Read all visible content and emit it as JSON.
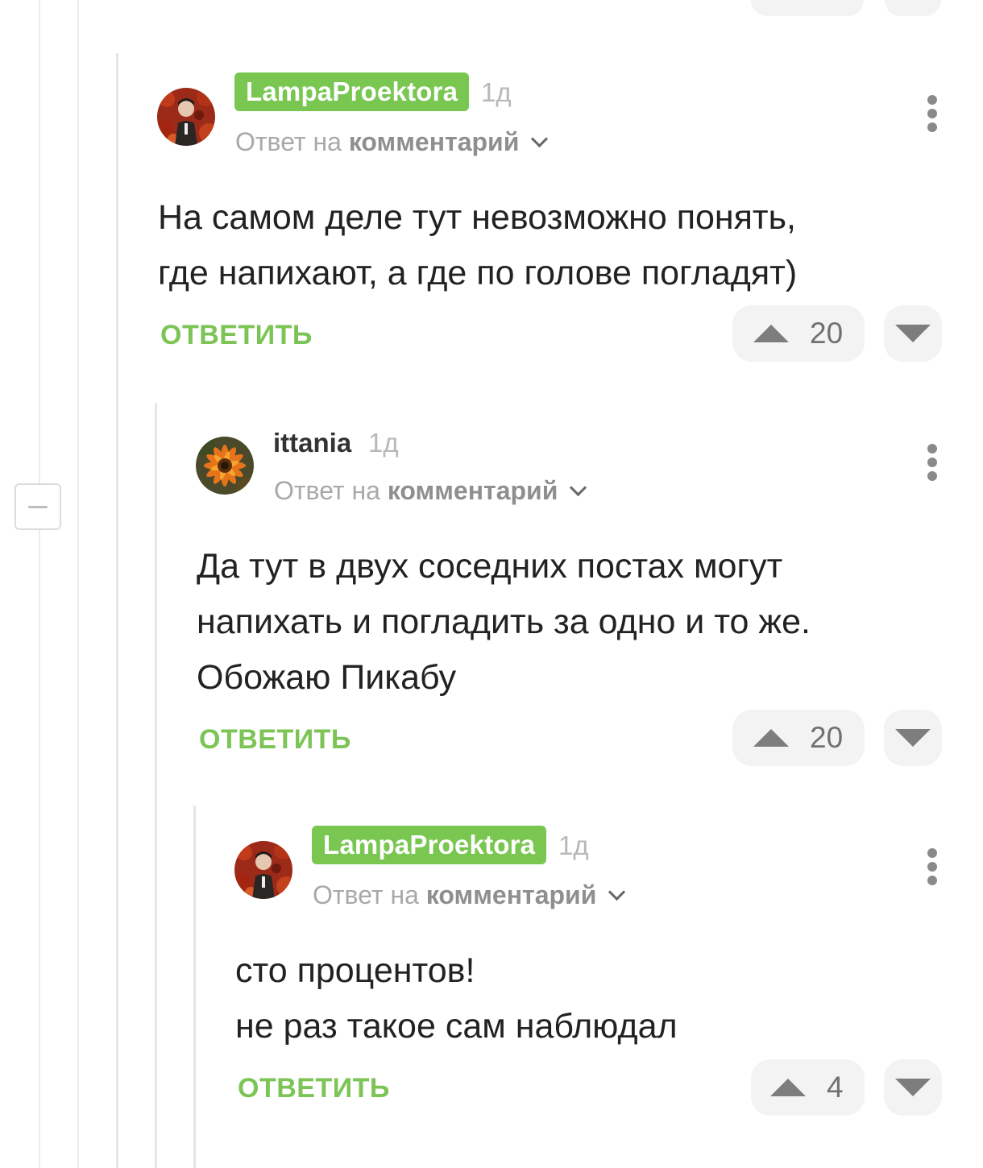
{
  "comments": [
    {
      "author": "LampaProektora",
      "author_style": "badge",
      "time": "1д",
      "reply_prefix": "Ответ на",
      "reply_target": "комментарий",
      "text": "На самом деле тут невозможно понять,\nгде напихают, а где по голове погладят)",
      "reply_label": "ОТВЕТИТЬ",
      "rating": "20"
    },
    {
      "author": "ittania",
      "author_style": "plain",
      "time": "1д",
      "reply_prefix": "Ответ на",
      "reply_target": "комментарий",
      "text": "Да тут в двух соседних постах могут\nнапихать и погладить за одно и то же.\nОбожаю Пикабу",
      "reply_label": "ОТВЕТИТЬ",
      "rating": "20"
    },
    {
      "author": "LampaProektora",
      "author_style": "badge",
      "time": "1д",
      "reply_prefix": "Ответ на",
      "reply_target": "комментарий",
      "text": "сто процентов!\nне раз такое сам наблюдал",
      "reply_label": "ОТВЕТИТЬ",
      "rating": "4"
    }
  ],
  "colors": {
    "accent_green": "#79c651",
    "reply_green": "#7cc455",
    "meta_gray": "#a9a9a9",
    "vote_bg": "#f3f3f4"
  },
  "icons": {
    "collapse": "minus-icon",
    "menu": "kebab-menu-icon",
    "expand": "chevron-down-icon",
    "upvote": "triangle-up-icon",
    "downvote": "triangle-down-icon"
  }
}
